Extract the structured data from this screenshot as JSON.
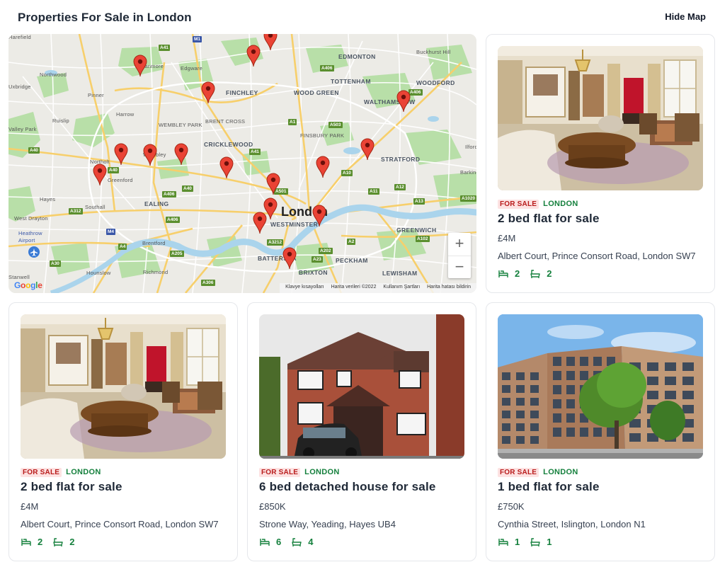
{
  "header": {
    "title": "Properties For Sale in London",
    "hide_map_label": "Hide Map"
  },
  "map": {
    "city_label": "London",
    "labels": [
      "Stanmore",
      "Edgware",
      "EDMONTON",
      "Buckhurst Hill",
      "Northwood",
      "FINCHLEY",
      "WOOD GREEN",
      "TOTTENHAM",
      "WOODFORD",
      "Pinner",
      "Harrow",
      "WALTHAMSTOW",
      "Ruislip",
      "BRENT CROSS",
      "FINSBURY PARK",
      "Valley Park",
      "WEMBLEY PARK",
      "CRICKLEWOOD",
      "Ilford",
      "Northolt",
      "STRATFORD",
      "Greenford",
      "Barking",
      "Hayes",
      "EALING",
      "Southall",
      "West Drayton",
      "WESTMINSTER",
      "GREENWICH",
      "Heathrow Airport",
      "Brentford",
      "BATTERSEA",
      "PECKHAM",
      "Hounslow",
      "Richmond",
      "BRIXTON",
      "LEWISHAM",
      "Stanwell",
      "Wembley",
      "Uxbridge",
      "Harefield"
    ],
    "attribution": [
      "Klavye kısayolları",
      "Harita verileri ©2022",
      "Kullanım Şartları",
      "Harita hatası bildirin"
    ],
    "google_logo": "Google",
    "zoom_in": "+",
    "zoom_out": "−",
    "pin_color": "#ea4335"
  },
  "listings": [
    {
      "status": "FOR SALE",
      "location": "LONDON",
      "title": "2 bed flat for sale",
      "price": "£4M",
      "address": "Albert Court, Prince Consort Road, London SW7",
      "beds": "2",
      "baths": "2",
      "image": "living-room"
    },
    {
      "status": "FOR SALE",
      "location": "LONDON",
      "title": "2 bed flat for sale",
      "price": "£4M",
      "address": "Albert Court, Prince Consort Road, London SW7",
      "beds": "2",
      "baths": "2",
      "image": "living-room"
    },
    {
      "status": "FOR SALE",
      "location": "LONDON",
      "title": "6 bed detached house for sale",
      "price": "£850K",
      "address": "Strone Way, Yeading, Hayes UB4",
      "beds": "6",
      "baths": "4",
      "image": "brick-house"
    },
    {
      "status": "FOR SALE",
      "location": "LONDON",
      "title": "1 bed flat for sale",
      "price": "£750K",
      "address": "Cynthia Street, Islington, London N1",
      "beds": "1",
      "baths": "1",
      "image": "apartment-block"
    }
  ],
  "colors": {
    "accent_green": "#15803d",
    "sale_red": "#b91c1c",
    "sale_bg": "#fde2e2"
  },
  "icons": {
    "bed": "bed-icon",
    "bath": "bath-icon",
    "marker": "map-pin-icon"
  }
}
